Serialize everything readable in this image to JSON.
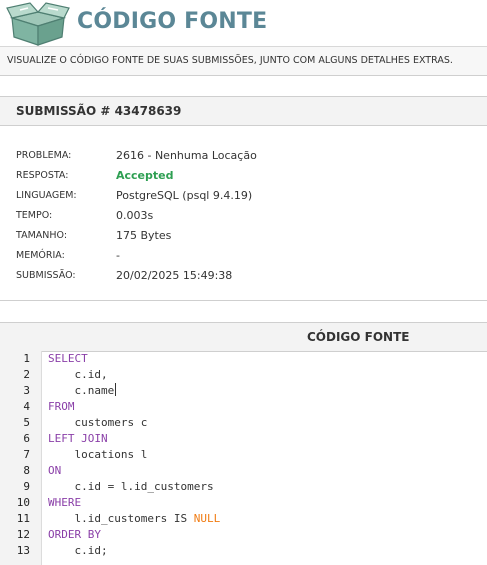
{
  "header": {
    "title": "CÓDIGO FONTE"
  },
  "description": "VISUALIZE O CÓDIGO FONTE DE SUAS SUBMISSÕES, JUNTO COM ALGUNS DETALHES EXTRAS.",
  "submission": {
    "heading": "SUBMISSÃO # 43478639",
    "fields": [
      {
        "label": "PROBLEMA:",
        "value": "2616 - Nenhuma Locação"
      },
      {
        "label": "RESPOSTA:",
        "value": "Accepted"
      },
      {
        "label": "LINGUAGEM:",
        "value": "PostgreSQL (psql 9.4.19)"
      },
      {
        "label": "TEMPO:",
        "value": "0.003s"
      },
      {
        "label": "TAMANHO:",
        "value": "175 Bytes"
      },
      {
        "label": "MEMÓRIA:",
        "value": "-"
      },
      {
        "label": "SUBMISSÃO:",
        "value": "20/02/2025 15:49:38"
      }
    ]
  },
  "code": {
    "title": "CÓDIGO FONTE",
    "lines": [
      {
        "n": "1",
        "indent": "",
        "parts": [
          {
            "t": "SELECT",
            "k": "kw"
          }
        ]
      },
      {
        "n": "2",
        "indent": "    ",
        "parts": [
          {
            "t": "c.id,",
            "k": ""
          }
        ]
      },
      {
        "n": "3",
        "indent": "    ",
        "parts": [
          {
            "t": "c.name",
            "k": ""
          }
        ]
      },
      {
        "n": "4",
        "indent": "",
        "parts": [
          {
            "t": "FROM",
            "k": "kw"
          }
        ]
      },
      {
        "n": "5",
        "indent": "    ",
        "parts": [
          {
            "t": "customers c",
            "k": ""
          }
        ]
      },
      {
        "n": "6",
        "indent": "",
        "parts": [
          {
            "t": "LEFT JOIN",
            "k": "kw"
          }
        ]
      },
      {
        "n": "7",
        "indent": "    ",
        "parts": [
          {
            "t": "locations l",
            "k": ""
          }
        ]
      },
      {
        "n": "8",
        "indent": "",
        "parts": [
          {
            "t": "ON",
            "k": "kw"
          }
        ]
      },
      {
        "n": "9",
        "indent": "    ",
        "parts": [
          {
            "t": "c.id = l.id_customers",
            "k": ""
          }
        ]
      },
      {
        "n": "10",
        "indent": "",
        "parts": [
          {
            "t": "WHERE",
            "k": "kw"
          }
        ]
      },
      {
        "n": "11",
        "indent": "    ",
        "parts": [
          {
            "t": "l.id_customers IS ",
            "k": ""
          },
          {
            "t": "NULL",
            "k": "lit"
          }
        ]
      },
      {
        "n": "12",
        "indent": "",
        "parts": [
          {
            "t": "ORDER BY",
            "k": "kw"
          }
        ]
      },
      {
        "n": "13",
        "indent": "    ",
        "parts": [
          {
            "t": "c.id;",
            "k": ""
          }
        ]
      }
    ]
  },
  "colors": {
    "title": "#5b8796",
    "accepted": "#2e9f52",
    "keyword": "#8a3fa8",
    "literal": "#f07b12"
  },
  "icons": {
    "logo": "open-box-icon"
  }
}
